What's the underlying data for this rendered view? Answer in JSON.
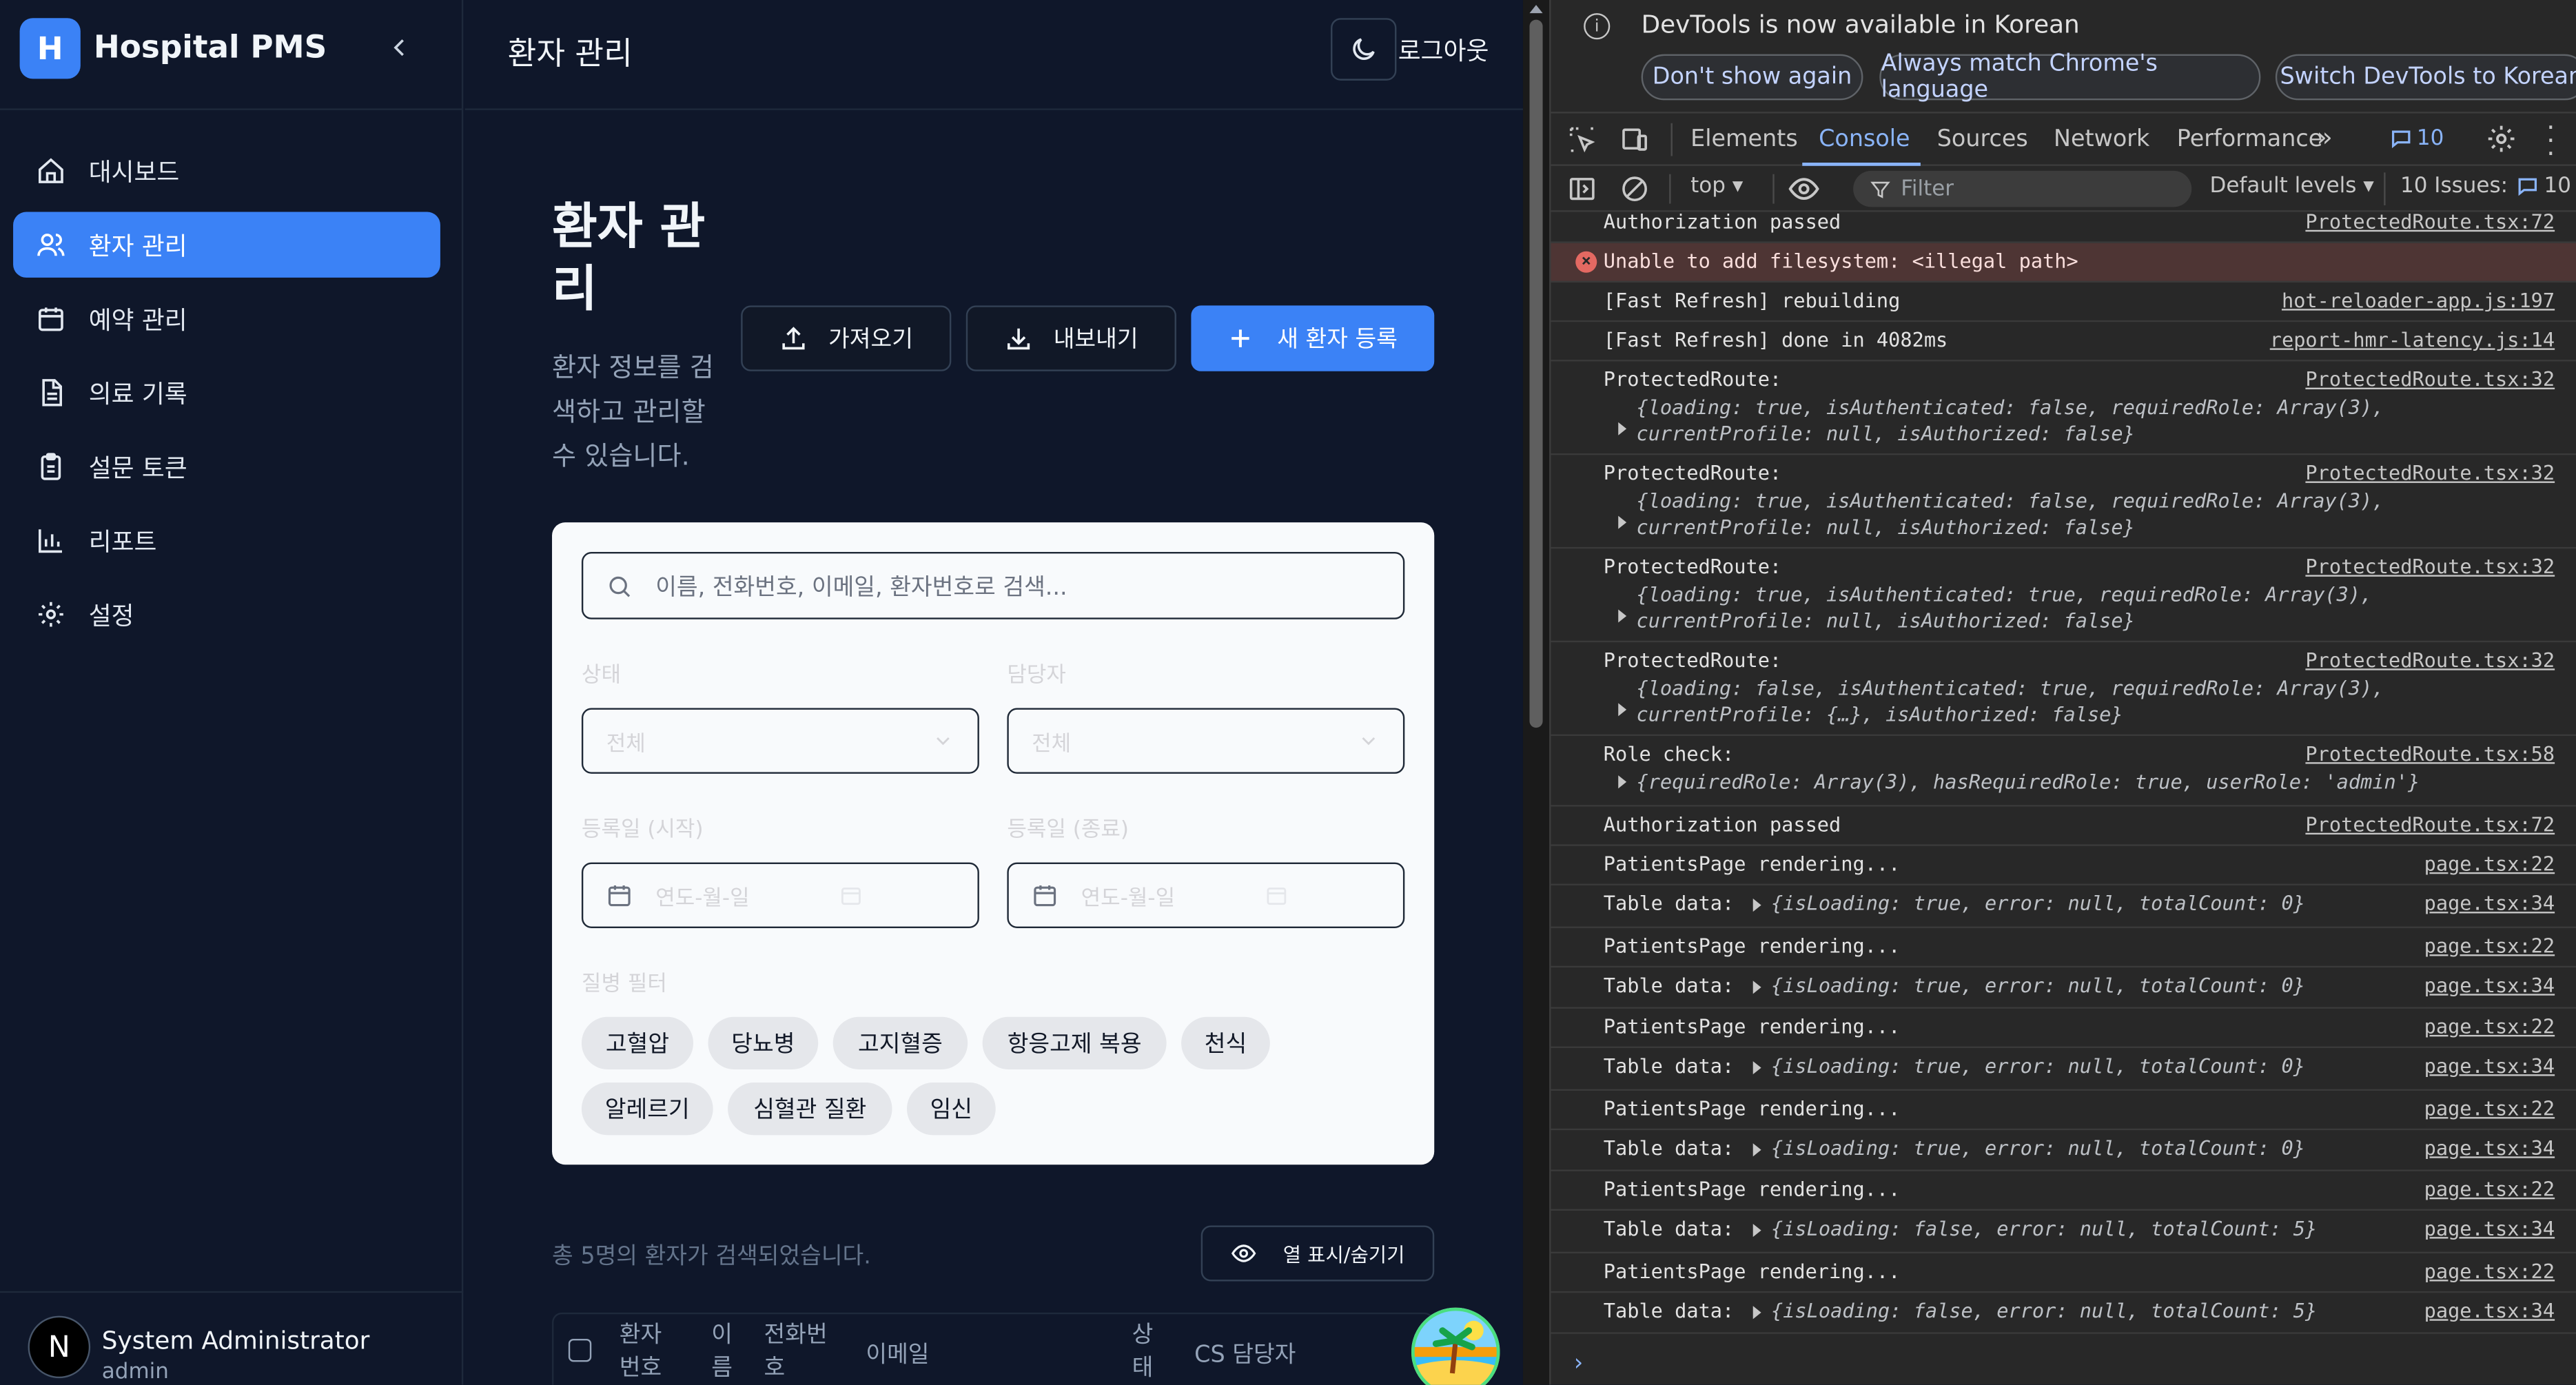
{
  "sidebar": {
    "logo_letter": "H",
    "title": "Hospital PMS",
    "items": [
      {
        "label": "대시보드",
        "icon": "home-icon"
      },
      {
        "label": "환자 관리",
        "icon": "users-icon"
      },
      {
        "label": "예약 관리",
        "icon": "calendar-icon"
      },
      {
        "label": "의료 기록",
        "icon": "file-icon"
      },
      {
        "label": "설문 토큰",
        "icon": "clipboard-icon"
      },
      {
        "label": "리포트",
        "icon": "bar-chart-icon"
      },
      {
        "label": "설정",
        "icon": "gear-icon"
      }
    ],
    "user": {
      "avatar": "N",
      "name": "System Administrator",
      "role": "admin"
    }
  },
  "topbar": {
    "title": "환자 관리",
    "logout": "로그아웃"
  },
  "page": {
    "heading": "환자 관리",
    "subtitle": "환자 정보를 검색하고 관리할 수 있습니다.",
    "import_label": "가져오기",
    "export_label": "내보내기",
    "new_label": "새 환자 등록"
  },
  "filters": {
    "search_placeholder": "이름, 전화번호, 이메일, 환자번호로 검색...",
    "status_label": "상태",
    "status_value": "전체",
    "manager_label": "담당자",
    "manager_value": "전체",
    "start_label": "등록일 (시작)",
    "end_label": "등록일 (종료)",
    "date_placeholder": "연도-월-일",
    "disease_label": "질병 필터",
    "diseases": [
      "고혈압",
      "당뇨병",
      "고지혈증",
      "항응고제 복용",
      "천식",
      "알레르기",
      "심혈관 질환",
      "임신"
    ]
  },
  "results": {
    "count_text": "총 5명의 환자가 검색되었습니다.",
    "columns_button": "열 표시/숨기기"
  },
  "table": {
    "headers": [
      "환자 번호",
      "이 름",
      "전화번 호",
      "이메일",
      "상 태",
      "CS 담당자"
    ]
  },
  "devtools": {
    "notice": "DevTools is now available in Korean",
    "btn_dont_show": "Don't show again",
    "btn_match": "Always match Chrome's language",
    "btn_switch": "Switch DevTools to Korean",
    "tabs": [
      "Elements",
      "Console",
      "Sources",
      "Network",
      "Performance"
    ],
    "active_tab": "Console",
    "issue_badge": "10",
    "context": "top",
    "filter_placeholder": "Filter",
    "levels": "Default levels",
    "issues": "10 Issues:",
    "issues_count": "10",
    "logs": [
      {
        "text": "Authorization passed",
        "src": "ProtectedRoute.tsx:72"
      },
      {
        "text": "Unable to add filesystem: <illegal path>",
        "src": "",
        "error": true
      },
      {
        "text": "[Fast Refresh] rebuilding",
        "src": "hot-reloader-app.js:197"
      },
      {
        "text": "[Fast Refresh] done in 4082ms",
        "src": "report-hmr-latency.js:14"
      },
      {
        "text": "ProtectedRoute:",
        "src": "ProtectedRoute.tsx:32",
        "obj": "{loading: true, isAuthenticated: false, requiredRole: Array(3), currentProfile: null, isAuthorized: false}"
      },
      {
        "text": "ProtectedRoute:",
        "src": "ProtectedRoute.tsx:32",
        "obj": "{loading: true, isAuthenticated: false, requiredRole: Array(3), currentProfile: null, isAuthorized: false}"
      },
      {
        "text": "ProtectedRoute:",
        "src": "ProtectedRoute.tsx:32",
        "obj": "{loading: true, isAuthenticated: true, requiredRole: Array(3), currentProfile: null, isAuthorized: false}"
      },
      {
        "text": "ProtectedRoute:",
        "src": "ProtectedRoute.tsx:32",
        "obj": "{loading: false, isAuthenticated: true, requiredRole: Array(3), currentProfile: {…}, isAuthorized: false}"
      },
      {
        "text": "Role check:",
        "src": "ProtectedRoute.tsx:58",
        "obj": "{requiredRole: Array(3), hasRequiredRole: true, userRole: 'admin'}"
      },
      {
        "text": "Authorization passed",
        "src": "ProtectedRoute.tsx:72"
      },
      {
        "text": "PatientsPage rendering...",
        "src": "page.tsx:22"
      },
      {
        "text": "Table data:",
        "src": "page.tsx:34",
        "obj": "{isLoading: true, error: null, totalCount: 0}"
      },
      {
        "text": "PatientsPage rendering...",
        "src": "page.tsx:22"
      },
      {
        "text": "Table data:",
        "src": "page.tsx:34",
        "obj": "{isLoading: true, error: null, totalCount: 0}"
      },
      {
        "text": "PatientsPage rendering...",
        "src": "page.tsx:22"
      },
      {
        "text": "Table data:",
        "src": "page.tsx:34",
        "obj": "{isLoading: true, error: null, totalCount: 0}"
      },
      {
        "text": "PatientsPage rendering...",
        "src": "page.tsx:22"
      },
      {
        "text": "Table data:",
        "src": "page.tsx:34",
        "obj": "{isLoading: true, error: null, totalCount: 0}"
      },
      {
        "text": "PatientsPage rendering...",
        "src": "page.tsx:22"
      },
      {
        "text": "Table data:",
        "src": "page.tsx:34",
        "obj": "{isLoading: false, error: null, totalCount: 5}"
      },
      {
        "text": "PatientsPage rendering...",
        "src": "page.tsx:22"
      },
      {
        "text": "Table data:",
        "src": "page.tsx:34",
        "obj": "{isLoading: false, error: null, totalCount: 5}"
      }
    ]
  }
}
